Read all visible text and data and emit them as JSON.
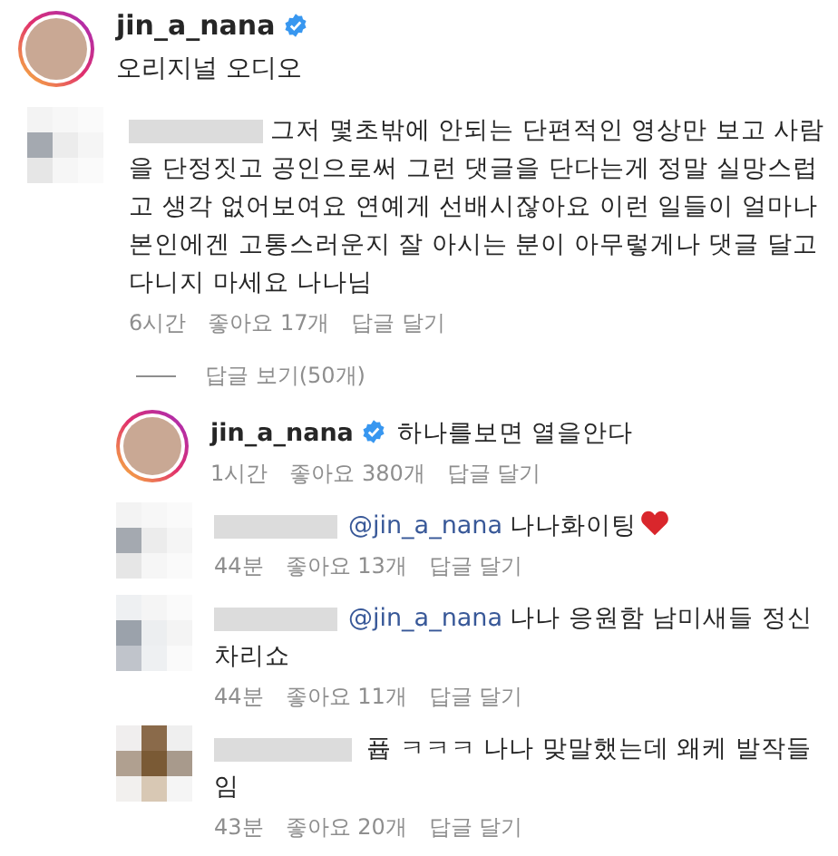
{
  "post": {
    "username": "jin_a_nana",
    "verified": true,
    "subtitle": "오리지널 오디오"
  },
  "comment": {
    "text": "그저 몇초밖에 안되는 단편적인 영상만 보고 사람을 단정짓고 공인으로써 그런 댓글을 단다는게 정말 실망스럽고 생각 없어보여요 연예게 선배시잖아요 이런 일들이 얼마나 본인에겐 고통스러운지 잘 아시는 분이 아무렇게나 댓글 달고 다니지 마세요 나나님",
    "time": "6시간",
    "likes": "좋아요 17개",
    "reply": "답글 달기"
  },
  "view_replies": "답글 보기(50개)",
  "replies": [
    {
      "kind": "author",
      "username": "jin_a_nana",
      "verified": true,
      "text": "하나를보면 열을안다",
      "heart": false,
      "time": "1시간",
      "likes": "좋아요 380개",
      "reply": "답글 달기"
    },
    {
      "kind": "blurred",
      "mention": "@jin_a_nana",
      "text": "나나화이팅",
      "heart": true,
      "time": "44분",
      "likes": "좋아요 13개",
      "reply": "답글 달기"
    },
    {
      "kind": "blurred",
      "mention": "@jin_a_nana",
      "text": "나나 응원함 남미새들 정신차리쇼",
      "heart": false,
      "time": "44분",
      "likes": "좋아요 11개",
      "reply": "답글 달기"
    },
    {
      "kind": "blurred",
      "text": "퓹 ㅋㅋㅋ 나나 맞말했는데 왜케 발작들임",
      "heart": false,
      "time": "43분",
      "likes": "좋아요 20개",
      "reply": "답글 달기"
    }
  ]
}
